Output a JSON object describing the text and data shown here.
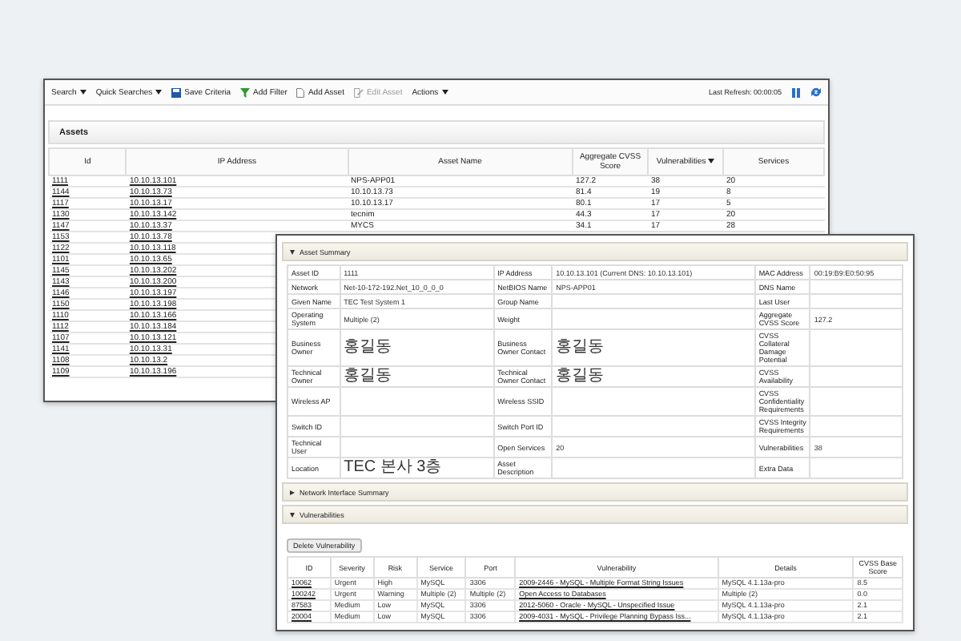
{
  "back_window": {
    "toolbar": {
      "items": [
        {
          "label": "Search",
          "kind": "menu",
          "disabled": false
        },
        {
          "label": "Quick Searches",
          "kind": "menu",
          "disabled": false
        },
        {
          "label": "Save Criteria",
          "kind": "save",
          "disabled": false
        },
        {
          "label": "Add Filter",
          "kind": "filter",
          "disabled": false
        },
        {
          "label": "Add Asset",
          "kind": "add",
          "disabled": false
        },
        {
          "label": "Edit Asset",
          "kind": "edit",
          "disabled": true
        },
        {
          "label": "Actions",
          "kind": "menu",
          "disabled": false
        }
      ],
      "refresh_label": "Last Refresh: 00:00:05"
    },
    "panel_title": "Assets",
    "table": {
      "columns": [
        {
          "label": "Id",
          "sorted": false
        },
        {
          "label": "IP Address",
          "sorted": false
        },
        {
          "label": "Asset Name",
          "sorted": false
        },
        {
          "label": "Aggregate CVSS Score",
          "sorted": false
        },
        {
          "label": "Vulnerabilities",
          "sorted": true
        },
        {
          "label": "Services",
          "sorted": false
        }
      ],
      "rows": [
        {
          "id": "1111",
          "ip": "10.10.13.101",
          "asset_name": "NPS-APP01",
          "cvss": "127.2",
          "vulnerabilities": "38",
          "services": "20"
        },
        {
          "id": "1144",
          "ip": "10.10.13.73",
          "asset_name": "10.10.13.73",
          "cvss": "81.4",
          "vulnerabilities": "19",
          "services": "8"
        },
        {
          "id": "1117",
          "ip": "10.10.13.17",
          "asset_name": "10.10.13.17",
          "cvss": "80.1",
          "vulnerabilities": "17",
          "services": "5"
        },
        {
          "id": "1130",
          "ip": "10.10.13.142",
          "asset_name": "tecnim",
          "cvss": "44.3",
          "vulnerabilities": "17",
          "services": "20"
        },
        {
          "id": "1147",
          "ip": "10.10.13.37",
          "asset_name": "MYCS",
          "cvss": "34.1",
          "vulnerabilities": "17",
          "services": "28"
        },
        {
          "id": "1153",
          "ip": "10.10.13.78"
        },
        {
          "id": "1122",
          "ip": "10.10.13.118"
        },
        {
          "id": "1101",
          "ip": "10.10.13.65"
        },
        {
          "id": "1145",
          "ip": "10.10.13.202"
        },
        {
          "id": "1143",
          "ip": "10.10.13.200"
        },
        {
          "id": "1146",
          "ip": "10.10.13.197"
        },
        {
          "id": "1150",
          "ip": "10.10.13.198"
        },
        {
          "id": "1110",
          "ip": "10.10.13.166"
        },
        {
          "id": "1112",
          "ip": "10.10.13.184"
        },
        {
          "id": "1107",
          "ip": "10.10.13.121"
        },
        {
          "id": "1141",
          "ip": "10.10.13.31"
        },
        {
          "id": "1108",
          "ip": "10.10.13.2"
        },
        {
          "id": "1109",
          "ip": "10.10.13.196"
        }
      ]
    }
  },
  "front_window": {
    "sections": [
      {
        "title": "Asset Summary",
        "expanded": true
      },
      {
        "title": "Network Interface Summary",
        "expanded": false
      },
      {
        "title": "Vulnerabilities",
        "expanded": true
      }
    ],
    "summary_rows": [
      [
        {
          "label": "Asset ID",
          "value": "1111"
        },
        {
          "label": "IP Address",
          "value": "10.10.13.101 (Current DNS: 10.10.13.101)"
        },
        {
          "label": "MAC Address",
          "value": "00:19:B9:E0:50:95"
        }
      ],
      [
        {
          "label": "Network",
          "value": "Net-10-172-192.Net_10_0_0_0"
        },
        {
          "label": "NetBIOS Name",
          "value": "NPS-APP01"
        },
        {
          "label": "DNS Name"
        }
      ],
      [
        {
          "label": "Given Name",
          "value": "TEC Test System 1"
        },
        {
          "label": "Group Name"
        },
        {
          "label": "Last User"
        }
      ],
      [
        {
          "label": "Operating System",
          "value": "Multiple (2)"
        },
        {
          "label": "Weight"
        },
        {
          "label": "Aggregate CVSS Score",
          "value": "127.2"
        }
      ],
      [
        {
          "label": "Business Owner",
          "value": "홍길동"
        },
        {
          "label": "Business Owner Contact",
          "value": "홍길동"
        },
        {
          "label": "CVSS Collateral Damage Potential"
        }
      ],
      [
        {
          "label": "Technical Owner",
          "value": "홍길동"
        },
        {
          "label": "Technical Owner Contact",
          "value": "홍길동"
        },
        {
          "label": "CVSS Availability"
        }
      ],
      [
        {
          "label": "Wireless AP"
        },
        {
          "label": "Wireless SSID"
        },
        {
          "label": "CVSS Confidentiality Requirements"
        }
      ],
      [
        {
          "label": "Switch ID"
        },
        {
          "label": "Switch Port ID"
        },
        {
          "label": "CVSS Integrity Requirements"
        }
      ],
      [
        {
          "label": "Technical User"
        },
        {
          "label": "Open Services",
          "value": "20"
        },
        {
          "label": "Vulnerabilities",
          "value": "38"
        }
      ],
      [
        {
          "label": "Location",
          "value": "TEC 본사 3층"
        },
        {
          "label": "Asset Description"
        },
        {
          "label": "Extra Data"
        }
      ]
    ],
    "delete_button": "Delete Vulnerability",
    "vuln_columns": [
      "ID",
      "Severity",
      "Risk",
      "Service",
      "Port",
      "Vulnerability",
      "Details",
      "CVSS Base Score"
    ],
    "vuln_rows": [
      [
        "10062",
        "Urgent",
        "High",
        "MySQL",
        "3306",
        "2009-2446 - MySQL - Multiple Format String Issues",
        "MySQL 4.1.13a-pro",
        "8.5"
      ],
      [
        "100242",
        "Urgent",
        "Warning",
        "Multiple (2)",
        "Multiple (2)",
        "Open Access to Databases",
        "Multiple (2)",
        "0.0"
      ],
      [
        "87583",
        "Medium",
        "Low",
        "MySQL",
        "3306",
        "2012-5060 - Oracle - MySQL - Unspecified Issue",
        "MySQL 4.1.13a-pro",
        "2.1"
      ],
      [
        "20004",
        "Medium",
        "Low",
        "MySQL",
        "3306",
        "2009-4031 - MySQL - Privilege Planning Bypass Iss...",
        "MySQL 4.1.13a-pro",
        "2.1"
      ]
    ]
  }
}
